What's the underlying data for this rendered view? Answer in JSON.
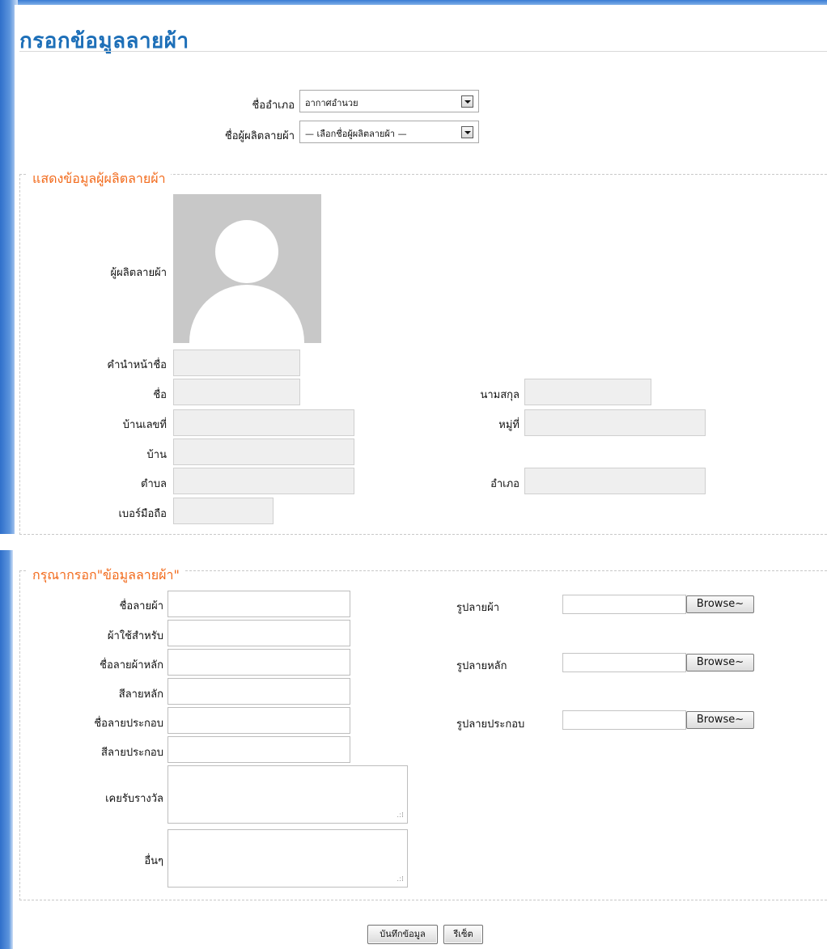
{
  "page": {
    "title": "กรอกข้อมูลลายผ้า"
  },
  "filters": {
    "district_label": "ชื่ออำเภอ",
    "district_value": "อากาศอำนวย",
    "producer_label": "ชื่อผู้ผลิตลายผ้า",
    "producer_value": "— เลือกชื่อผู้ผลิตลายผ้า —"
  },
  "producer_info": {
    "legend": "แสดงข้อมูลผู้ผลิตลายผ้า",
    "photo_label": "ผู้ผลิตลายผ้า",
    "fields": {
      "prefix": "คำนำหน้าชื่อ",
      "first_name": "ชื่อ",
      "last_name": "นามสกุล",
      "house_no": "บ้านเลขที่",
      "moo": "หมู่ที่",
      "village": "บ้าน",
      "subdistrict": "ตำบล",
      "district": "อำเภอ",
      "mobile": "เบอร์มือถือ"
    }
  },
  "pattern_form": {
    "legend": "กรุณากรอก\"ข้อมูลลายผ้า\"",
    "fields": {
      "pattern_name": "ชื่อลายผ้า",
      "used_for": "ผ้าใช้สำหรับ",
      "main_pattern_name": "ชื่อลายผ้าหลัก",
      "main_pattern_color": "สีลายหลัก",
      "accent_pattern_name": "ชื่อลายประกอบ",
      "accent_pattern_color": "สีลายประกอบ",
      "awards": "เคยรับรางวัล",
      "other": "อื่นๆ"
    },
    "images": {
      "pattern_image": "รูปลายผ้า",
      "main_pattern_image": "รูปลายหลัก",
      "accent_pattern_image": "รูปลายประกอบ",
      "browse_label": "Browse~"
    }
  },
  "actions": {
    "save": "บันทึกข้อมูล",
    "reset": "รีเซ็ต"
  }
}
